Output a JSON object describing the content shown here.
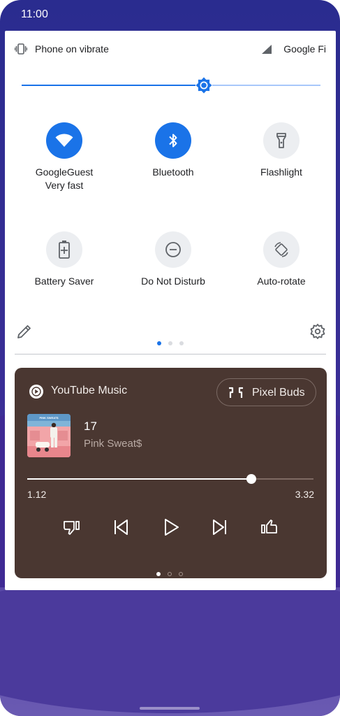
{
  "status_bar": {
    "time": "11:00"
  },
  "quick_settings": {
    "ringer": {
      "icon": "vibrate-icon",
      "label": "Phone on vibrate"
    },
    "network": {
      "icon": "cell-signal-icon",
      "carrier": "Google Fi"
    },
    "brightness": {
      "level": 0.61,
      "accent": "#1a73e8"
    },
    "tiles": [
      {
        "icon": "wifi-icon",
        "label": "GoogleGuest",
        "sublabel": "Very fast",
        "active": true
      },
      {
        "icon": "bluetooth-icon",
        "label": "Bluetooth",
        "active": true
      },
      {
        "icon": "flashlight-icon",
        "label": "Flashlight",
        "active": false
      },
      {
        "icon": "battery-saver-icon",
        "label": "Battery Saver",
        "active": false
      },
      {
        "icon": "do-not-disturb-icon",
        "label": "Do Not Disturb",
        "active": false
      },
      {
        "icon": "auto-rotate-icon",
        "label": "Auto-rotate",
        "active": false
      }
    ],
    "pages": {
      "count": 3,
      "current": 1
    }
  },
  "media": {
    "app_icon": "youtube-music-icon",
    "app_name": "YouTube Music",
    "output_device": {
      "icon": "earbuds-icon",
      "label": "Pixel Buds"
    },
    "track": {
      "title": "17",
      "artist": "Pink Sweat$",
      "art_caption": "PINK SWEAT$"
    },
    "elapsed": "1.12",
    "total": "3.32",
    "progress": 0.782,
    "controls": [
      "thumbs-down-icon",
      "skip-previous-icon",
      "play-icon",
      "skip-next-icon",
      "thumbs-up-icon"
    ],
    "pages": {
      "count": 3,
      "current": 1
    },
    "background": "#4a3731"
  }
}
